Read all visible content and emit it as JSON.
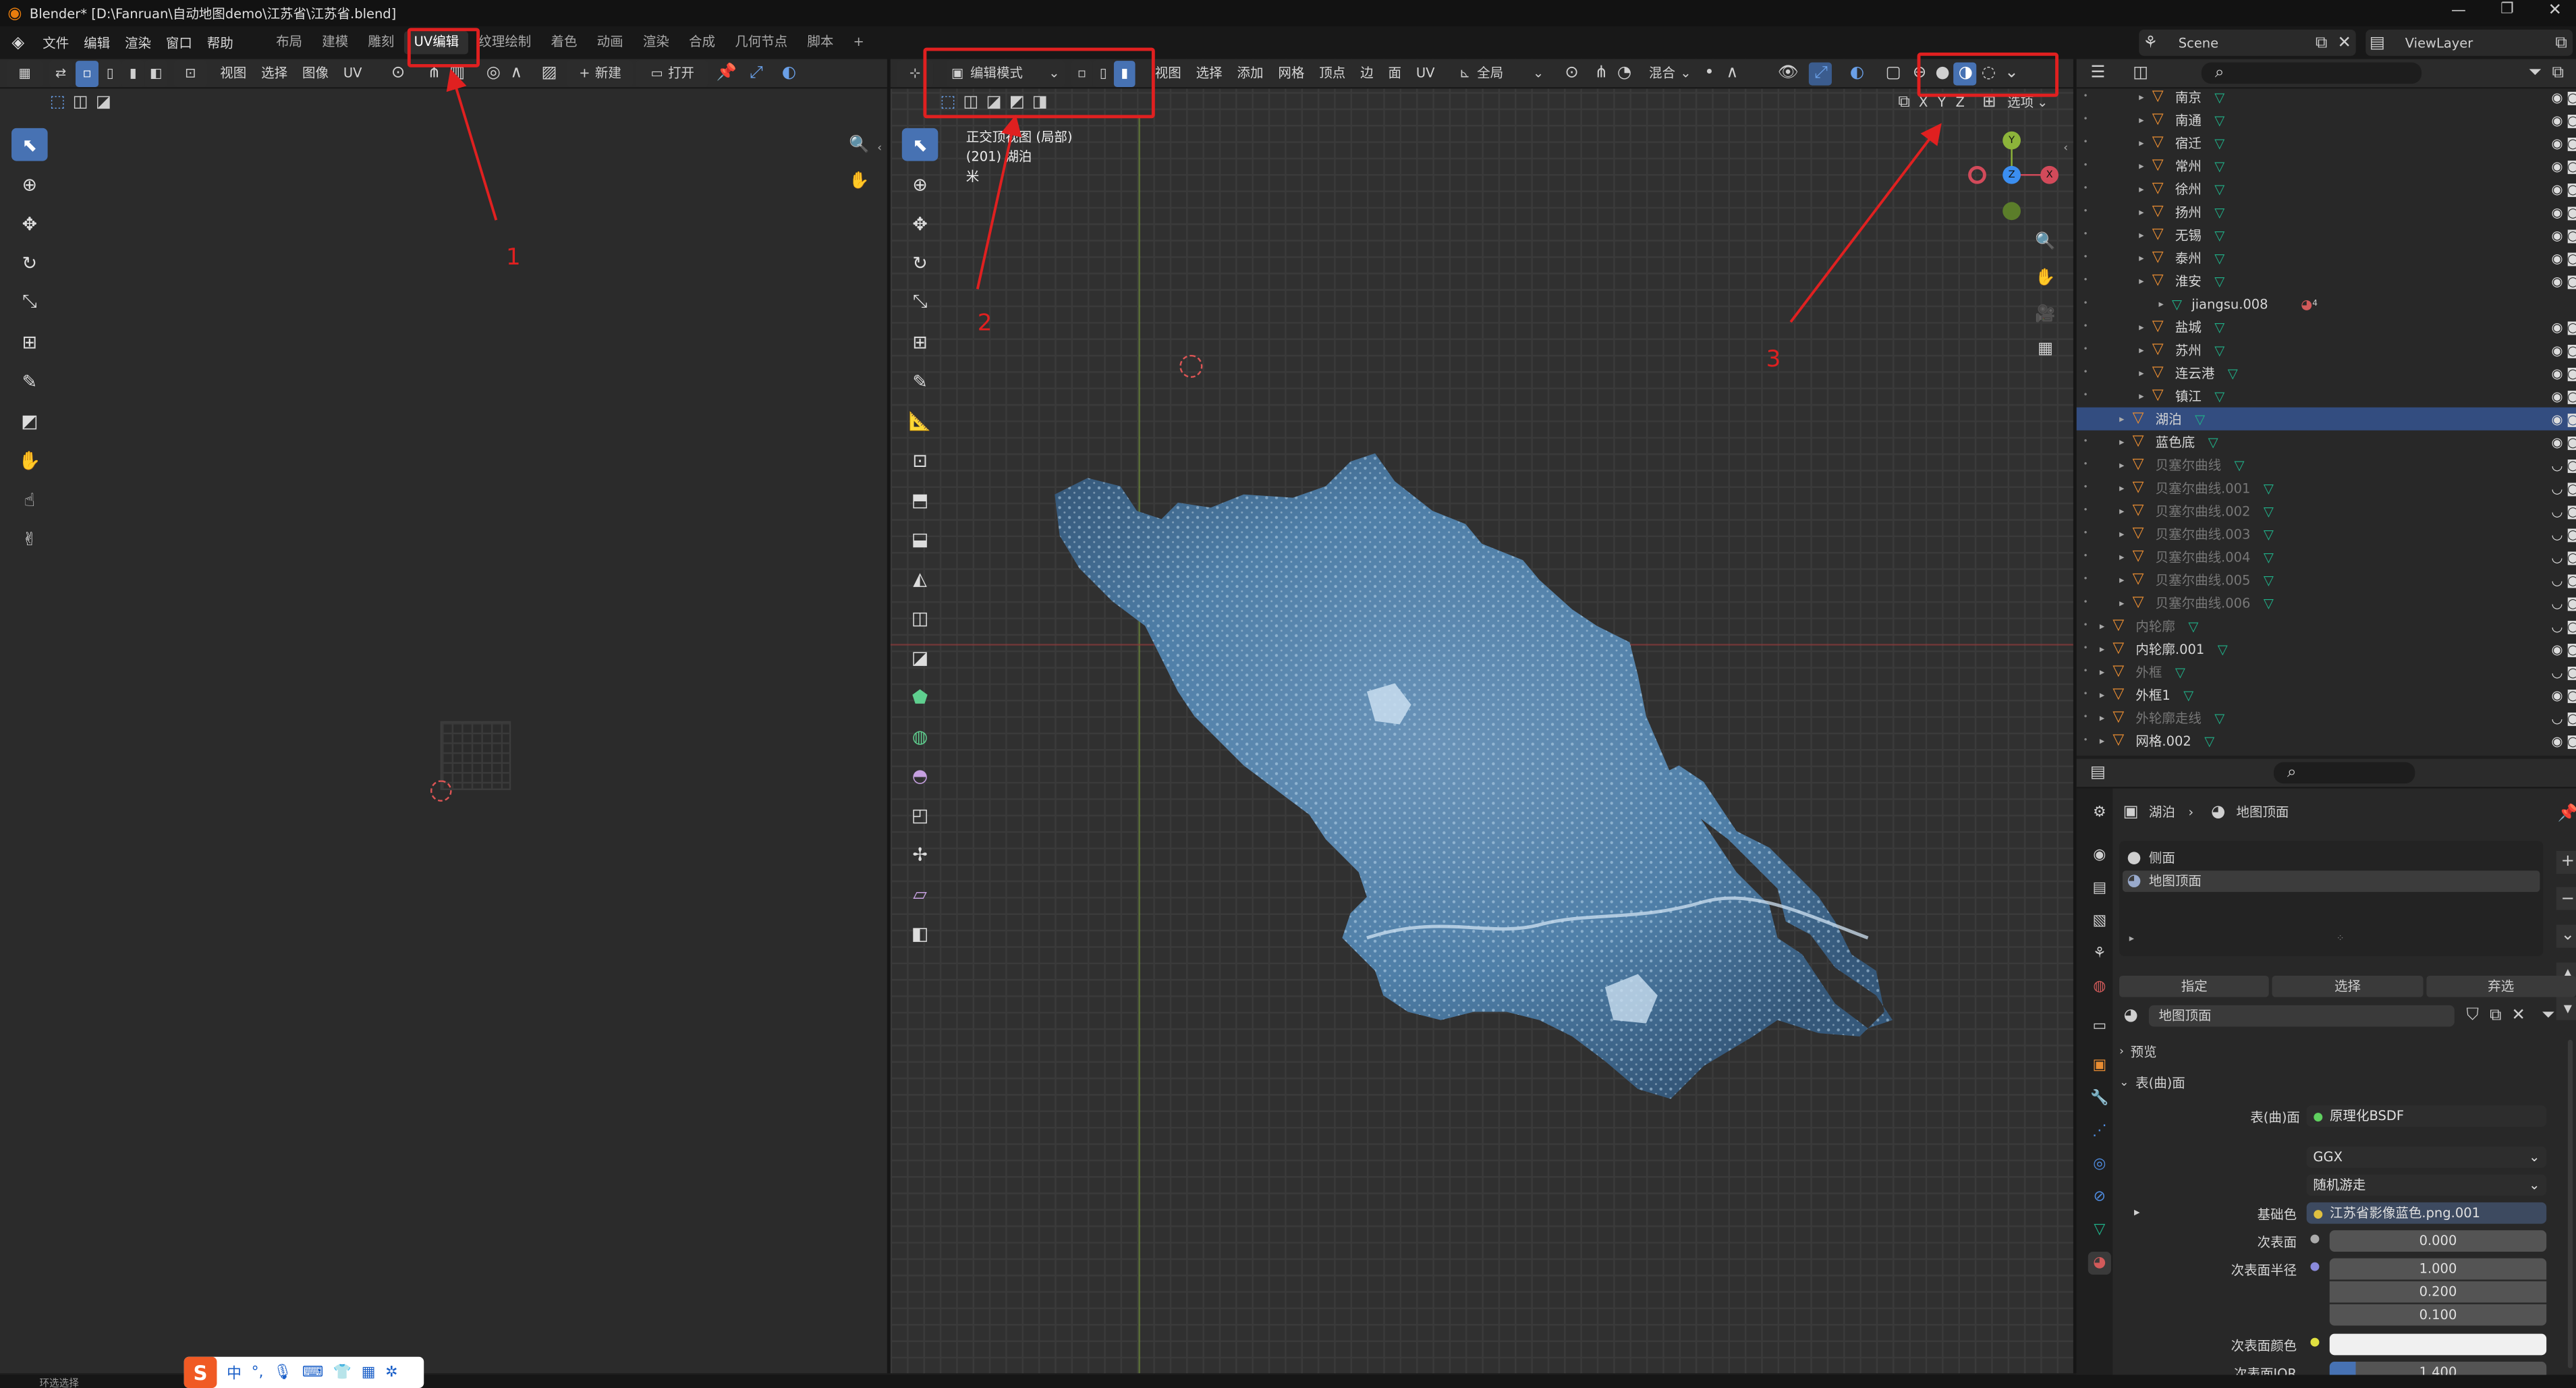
{
  "window": {
    "title": "Blender* [D:\\Fanruan\\自动地图demo\\江苏省\\江苏省.blend]"
  },
  "topbar": {
    "menus": [
      "文件",
      "编辑",
      "渲染",
      "窗口",
      "帮助"
    ],
    "tabs": [
      "布局",
      "建模",
      "雕刻",
      "UV编辑",
      "纹理绘制",
      "着色",
      "动画",
      "渲染",
      "合成",
      "几何节点",
      "脚本"
    ],
    "active_tab": "UV编辑",
    "add_tab": "+",
    "scene_label": "Scene",
    "viewlayer_label": "ViewLayer"
  },
  "uv_editor": {
    "menus": [
      "视图",
      "选择",
      "图像",
      "UV"
    ],
    "new_button": "新建",
    "open_button": "打开"
  },
  "viewport": {
    "mode": "编辑模式",
    "menus": [
      "视图",
      "选择",
      "添加",
      "网格",
      "顶点",
      "边",
      "面",
      "UV"
    ],
    "transform_orientation": "全局",
    "proportional": "混合",
    "axis_x": "X",
    "axis_y": "Y",
    "axis_z": "Z",
    "options": "选项",
    "overlay_line1": "正交顶视图 (局部)",
    "overlay_line2": "(201) 湖泊",
    "overlay_line3": "米",
    "gizmo_x": "X",
    "gizmo_y": "Y",
    "gizmo_z": "Z"
  },
  "annotations": {
    "n1": "1",
    "n2": "2",
    "n3": "3"
  },
  "outliner": {
    "items": [
      {
        "name": "南京",
        "indent": 2,
        "dim": false,
        "selected": false
      },
      {
        "name": "南通",
        "indent": 2,
        "dim": false,
        "selected": false
      },
      {
        "name": "宿迁",
        "indent": 2,
        "dim": false,
        "selected": false
      },
      {
        "name": "常州",
        "indent": 2,
        "dim": false,
        "selected": false
      },
      {
        "name": "徐州",
        "indent": 2,
        "dim": false,
        "selected": false
      },
      {
        "name": "扬州",
        "indent": 2,
        "dim": false,
        "selected": false
      },
      {
        "name": "无锡",
        "indent": 2,
        "dim": false,
        "selected": false
      },
      {
        "name": "泰州",
        "indent": 2,
        "dim": false,
        "selected": false
      },
      {
        "name": "淮安",
        "indent": 2,
        "dim": false,
        "selected": false
      },
      {
        "name": "jiangsu.008",
        "indent": 3,
        "dim": false,
        "selected": false,
        "mesh_only": true,
        "count": "4"
      },
      {
        "name": "盐城",
        "indent": 2,
        "dim": false,
        "selected": false
      },
      {
        "name": "苏州",
        "indent": 2,
        "dim": false,
        "selected": false
      },
      {
        "name": "连云港",
        "indent": 2,
        "dim": false,
        "selected": false
      },
      {
        "name": "镇江",
        "indent": 2,
        "dim": false,
        "selected": false
      },
      {
        "name": "湖泊",
        "indent": 1,
        "dim": false,
        "selected": true
      },
      {
        "name": "蓝色底",
        "indent": 1,
        "dim": false,
        "selected": false
      },
      {
        "name": "贝塞尔曲线",
        "indent": 1,
        "dim": true,
        "selected": false
      },
      {
        "name": "贝塞尔曲线.001",
        "indent": 1,
        "dim": true,
        "selected": false
      },
      {
        "name": "贝塞尔曲线.002",
        "indent": 1,
        "dim": true,
        "selected": false
      },
      {
        "name": "贝塞尔曲线.003",
        "indent": 1,
        "dim": true,
        "selected": false
      },
      {
        "name": "贝塞尔曲线.004",
        "indent": 1,
        "dim": true,
        "selected": false
      },
      {
        "name": "贝塞尔曲线.005",
        "indent": 1,
        "dim": true,
        "selected": false
      },
      {
        "name": "贝塞尔曲线.006",
        "indent": 1,
        "dim": true,
        "selected": false
      },
      {
        "name": "内轮廓",
        "indent": 0,
        "dim": true,
        "selected": false
      },
      {
        "name": "内轮廓.001",
        "indent": 0,
        "dim": false,
        "selected": false
      },
      {
        "name": "外框",
        "indent": 0,
        "dim": true,
        "selected": false
      },
      {
        "name": "外框1",
        "indent": 0,
        "dim": false,
        "selected": false
      },
      {
        "name": "外轮廓走线",
        "indent": 0,
        "dim": true,
        "selected": false
      },
      {
        "name": "网格.002",
        "indent": 0,
        "dim": false,
        "selected": false
      }
    ]
  },
  "properties": {
    "breadcrumb_object": "湖泊",
    "breadcrumb_material": "地图顶面",
    "slots": [
      "侧面",
      "地图顶面"
    ],
    "assign": "指定",
    "select": "选择",
    "deselect": "弃选",
    "material_name": "地图顶面",
    "preview": "预览",
    "surface_section": "表(曲)面",
    "surface_label": "表(曲)面",
    "surface_value": "原理化BSDF",
    "distribution": "GGX",
    "subsurface_method": "随机游走",
    "base_color_label": "基础色",
    "base_color_value": "江苏省影像蓝色.png.001",
    "subsurface_label": "次表面",
    "subsurface_value": "0.000",
    "subsurface_radius_label": "次表面半径",
    "radius": [
      "1.000",
      "0.200",
      "0.100"
    ],
    "subsurface_color_label": "次表面颜色",
    "subsurface_ior_label": "次表面IOR",
    "subsurface_ior_value": "1.400"
  },
  "statusbar": {
    "text": "环选选择"
  },
  "colors": {
    "accent": "#4772b3",
    "annotation_red": "#e02020",
    "object_orange": "#e88c32",
    "mesh_green": "#1fb38a",
    "map_blue": "#4f7fa8"
  }
}
